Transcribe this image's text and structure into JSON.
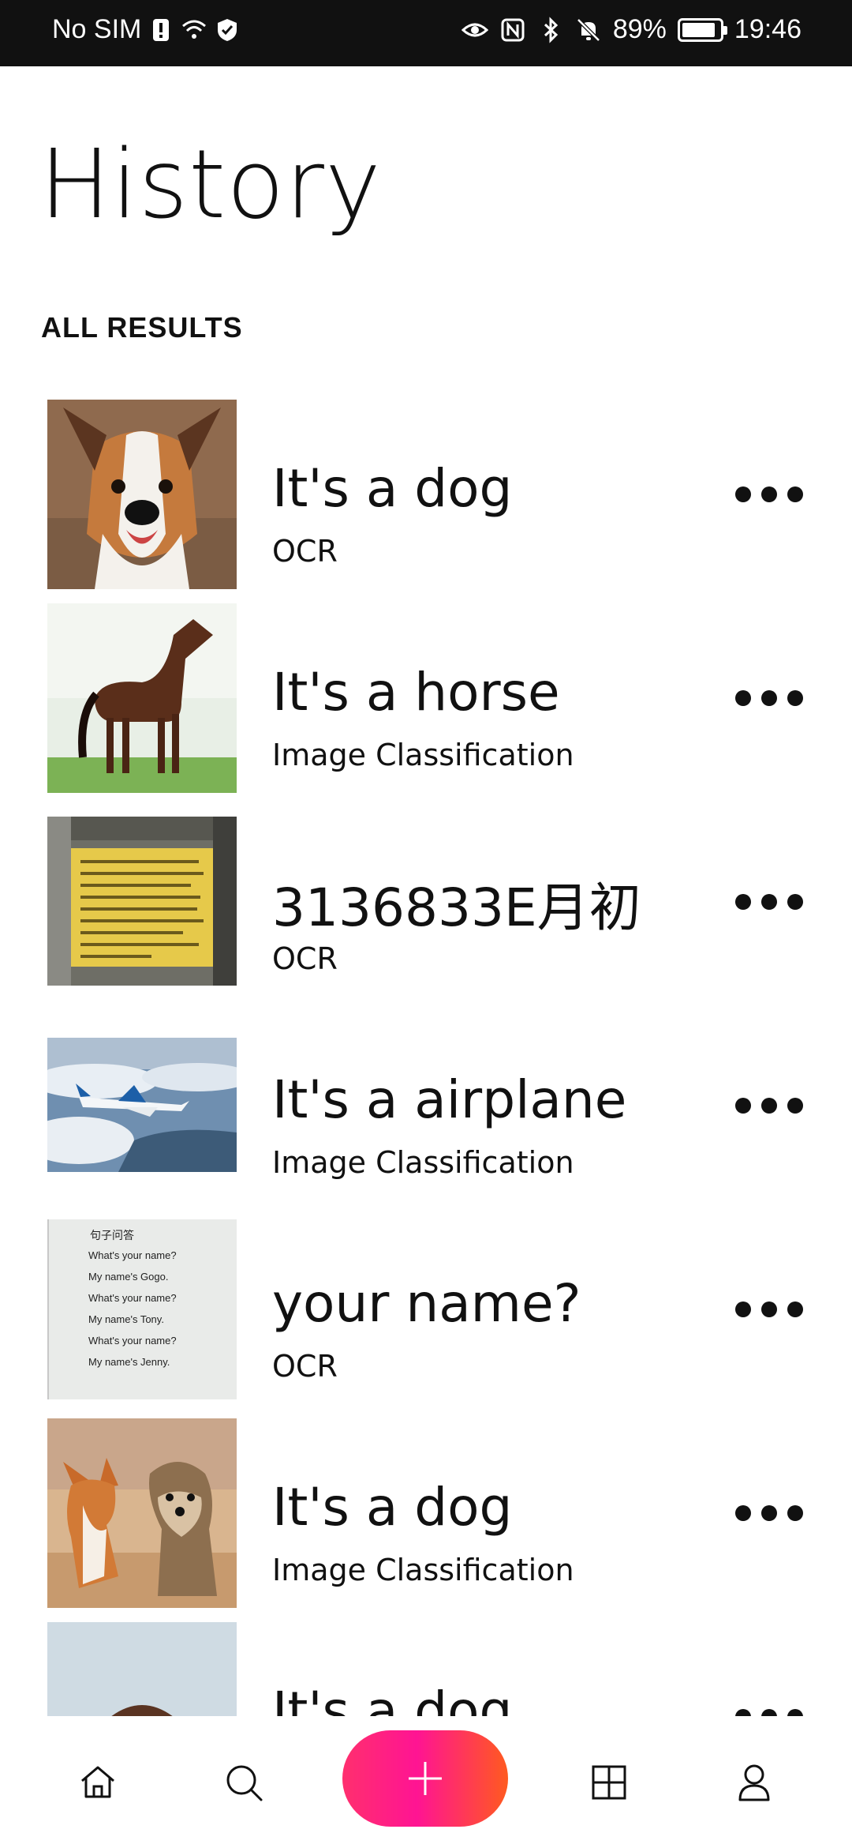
{
  "status_bar": {
    "carrier": "No SIM",
    "battery": "89%",
    "battery_level": 0.89,
    "time": "19:46"
  },
  "header": {
    "title": "History",
    "section_label": "ALL RESULTS"
  },
  "results": [
    {
      "title": "It's a dog",
      "type": "OCR",
      "thumbnail": "dog-portrait"
    },
    {
      "title": "It's a horse",
      "type": "Image Classification",
      "thumbnail": "horse"
    },
    {
      "title": "3136833E月初",
      "type": "OCR",
      "thumbnail": "yellow-note"
    },
    {
      "title": "It's a airplane",
      "type": "Image Classification",
      "thumbnail": "airplane"
    },
    {
      "title": "your name?",
      "type": "OCR",
      "thumbnail": "text-page"
    },
    {
      "title": "It's a dog",
      "type": "Image Classification",
      "thumbnail": "two-dogs"
    },
    {
      "title": "It's a dog",
      "type": "",
      "thumbnail": "dog-partial"
    }
  ],
  "thumbnail_text": {
    "line1": "句子问答",
    "line2": "What's your name?",
    "line3": "My name's Gogo.",
    "line4": "What's your name?",
    "line5": "My name's Tony.",
    "line6": "What's your name?",
    "line7": "My name's Jenny."
  },
  "bottom_nav": {
    "items": [
      "home-icon",
      "search-icon",
      "add-icon",
      "grid-icon",
      "profile-icon"
    ],
    "fab_gradient": [
      "#ff2f6e",
      "#ff1493",
      "#ff5a1f"
    ]
  }
}
